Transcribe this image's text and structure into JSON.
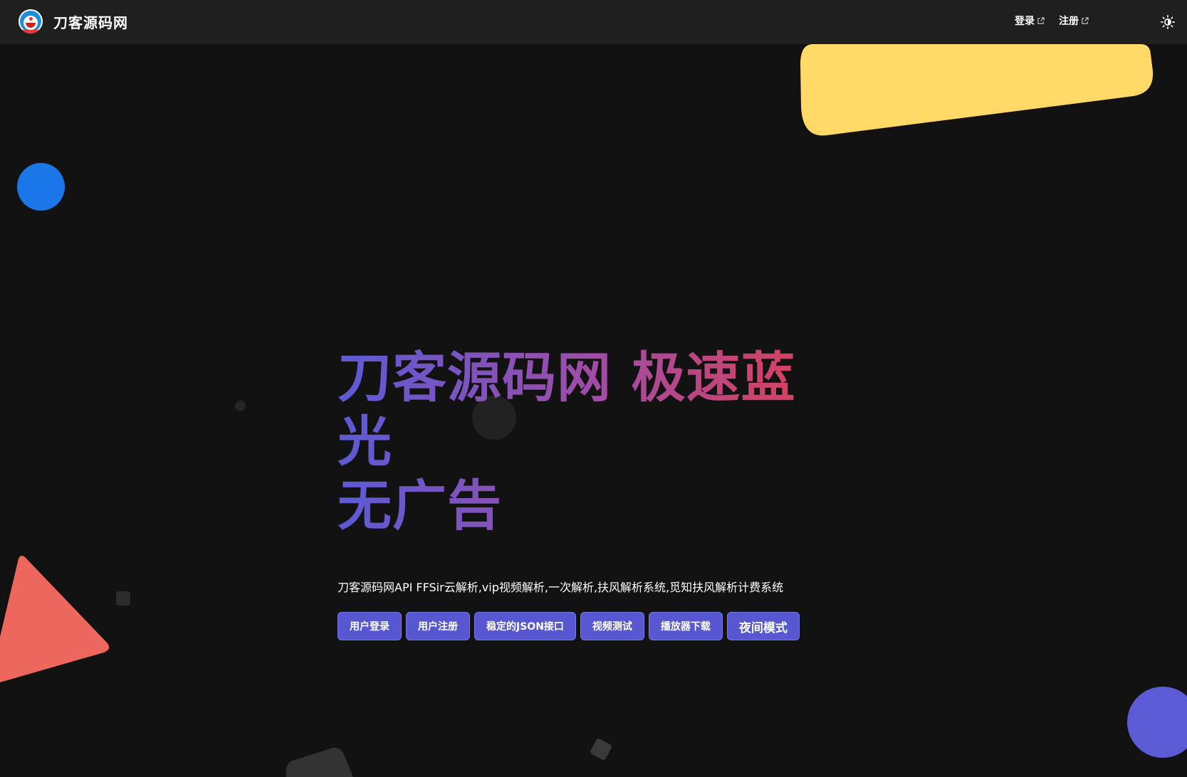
{
  "nav": {
    "brand": "刀客源码网",
    "links": [
      {
        "label": "登录"
      },
      {
        "label": "注册"
      }
    ],
    "theme_toggle_icon": "sun-icon"
  },
  "hero": {
    "title_line1": "刀客源码网 极速蓝光",
    "title_line2": "无广告",
    "subtitle": "刀客源码网API FFSir云解析,vip视频解析,一次解析,扶风解析系统,觅知扶风解析计费系统",
    "buttons": [
      {
        "label": "用户登录"
      },
      {
        "label": "用户注册"
      },
      {
        "label": "稳定的JSON接口"
      },
      {
        "label": "视频测试"
      },
      {
        "label": "播放器下载"
      },
      {
        "label": "夜间模式"
      }
    ]
  },
  "colors": {
    "background": "#121212",
    "navbar": "#1f1f1f",
    "button": "#5757d1",
    "gradient_start": "#5b5bd6",
    "gradient_end": "#e23f4f",
    "yellow_shape": "#ffd866",
    "blue_circle": "#1b76e8",
    "red_triangle": "#ee675c",
    "purple_circle": "#5b5bd6"
  }
}
